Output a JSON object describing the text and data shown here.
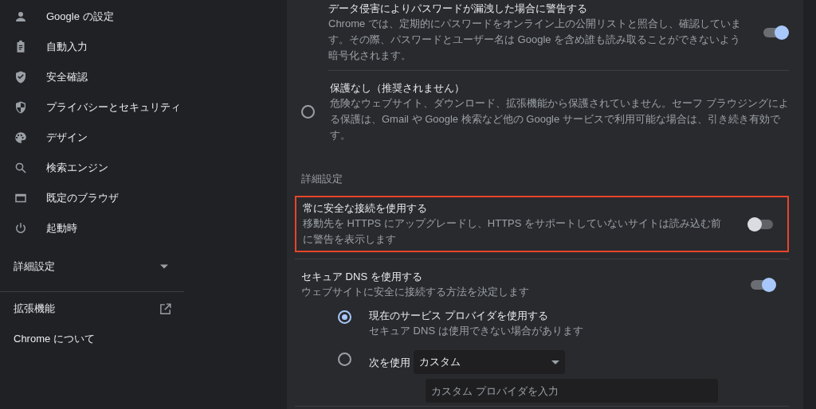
{
  "sidebar": {
    "items": [
      {
        "label": "Google の設定"
      },
      {
        "label": "自動入力"
      },
      {
        "label": "安全確認"
      },
      {
        "label": "プライバシーとセキュリティ"
      },
      {
        "label": "デザイン"
      },
      {
        "label": "検索エンジン"
      },
      {
        "label": "既定のブラウザ"
      },
      {
        "label": "起動時"
      }
    ],
    "advanced": {
      "label": "詳細設定",
      "expanded": false
    },
    "extensions": {
      "label": "拡張機能"
    },
    "about": {
      "label": "Chrome について"
    }
  },
  "safe_browsing": {
    "sub_option": {
      "title": "データ侵害によりパスワードが漏洩した場合に警告する",
      "description": "Chrome では、定期的にパスワードをオンライン上の公開リストと照合し、確認しています。その際、パスワードとユーザー名は Google を含め誰も読み取ることができないよう暗号化されます。",
      "on": true
    },
    "no_protection": {
      "title": "保護なし（推奨されません）",
      "description": "危険なウェブサイト、ダウンロード、拡張機能から保護されていません。セーフ ブラウジングによる保護は、Gmail や Google 検索など他の Google サービスで利用可能な場合は、引き続き有効です。",
      "selected": false
    }
  },
  "advanced": {
    "heading": "詳細設定",
    "https_only": {
      "title": "常に安全な接続を使用する",
      "description": "移動先を HTTPS にアップグレードし、HTTPS をサポートしていないサイトは読み込む前に警告を表示します",
      "on": false,
      "highlighted": true
    },
    "secure_dns": {
      "title": "セキュア DNS を使用する",
      "description": "ウェブサイトに安全に接続する方法を決定します",
      "on": true,
      "providers": [
        {
          "kind": "option",
          "label": "現在のサービス プロバイダを使用する",
          "description": "セキュア DNS は使用できない場合があります",
          "selected": true
        },
        {
          "kind": "custom",
          "label": "次を使用",
          "select_value": "カスタム",
          "placeholder": "カスタム プロバイダを入力",
          "selected": false
        }
      ]
    }
  }
}
